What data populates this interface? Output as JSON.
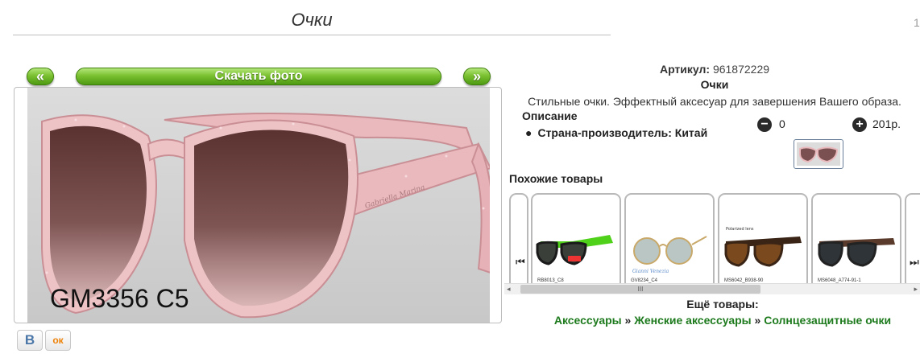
{
  "page": {
    "title": "Очки",
    "stray_mark": "1"
  },
  "gallery": {
    "prev_label": "«",
    "next_label": "»",
    "download_label": "Скачать фото",
    "photo_label": "GM3356 C5",
    "lens_brand_script": "Gabriella Marina"
  },
  "social": {
    "vk_label": "В",
    "ok_label": "ок"
  },
  "product": {
    "sku_label": "Артикул:",
    "sku_value": "961872229",
    "name": "Очки",
    "description": "Стильные очки. Эффектный аксесуар для завершения Вашего образа.",
    "description_heading": "Описание",
    "specs": [
      {
        "label": "Страна-производитель:",
        "value": "Китай"
      }
    ]
  },
  "cart": {
    "minus_icon": "−",
    "plus_icon": "+",
    "quantity": "0",
    "price": "201р."
  },
  "similar": {
    "heading": "Похожие товары",
    "items": [
      {
        "caption": "RB8013_C8",
        "frame_color": "#1a1a1a",
        "arm_color": "#4fd11a",
        "lens_color": "#3a3f3a"
      },
      {
        "caption": "GV8234_C4",
        "frame_color": "#c9a96a",
        "arm_color": "#c9a96a",
        "lens_color": "#b9c6c4"
      },
      {
        "caption": "MS6042_B938-90",
        "frame_color": "#3a2415",
        "arm_color": "#3a2415",
        "lens_color": "#7a4a1e"
      },
      {
        "caption": "MS6048_A774-91-1",
        "frame_color": "#222222",
        "arm_color": "#5a3a2a",
        "lens_color": "#2e3438"
      }
    ],
    "card2_brand": "Gianni Venezia",
    "card3_note": "Polarized lens",
    "left_icon": "⏮",
    "right_icon": "⏭"
  },
  "scrollbar": {
    "left": "◂",
    "right": "▸",
    "grip": "III"
  },
  "more": {
    "heading": "Ещё товары:",
    "crumbs": [
      "Аксессуары",
      "Женские аксессуары",
      "Солнцезащитные очки"
    ],
    "separator": " » "
  },
  "colors": {
    "accent_green": "#7bc131",
    "link_green": "#1d7a1d",
    "frame_pink": "#e9b9bd",
    "lens_brown": "#6b3f3c"
  }
}
